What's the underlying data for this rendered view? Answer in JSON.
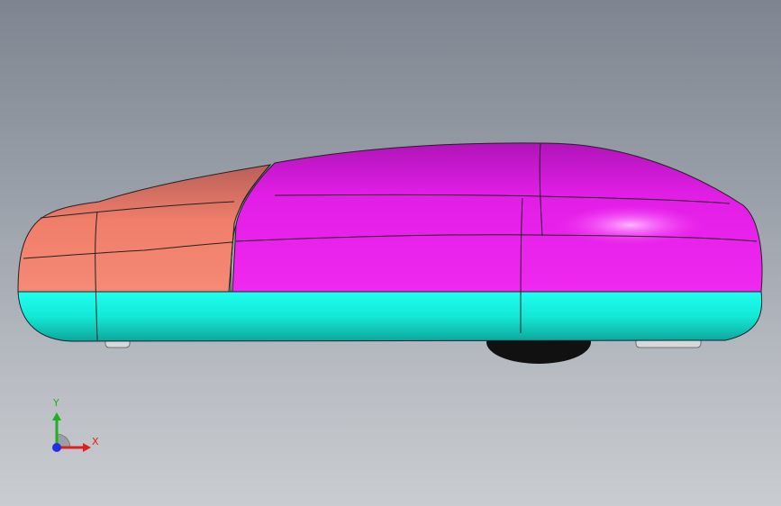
{
  "viewport": {
    "background_top": "#7e8590",
    "background_bottom": "#c9ccd0"
  },
  "model": {
    "body_colors": {
      "nose": "#f07e6a",
      "cabin": "#e81de8",
      "roof": "#b012b8",
      "underbody": "#18f0dc",
      "wheel": "#111111",
      "skid": "#d8d8d8"
    }
  },
  "triad": {
    "x_label": "X",
    "y_label": "Y",
    "x_color": "#e02020",
    "y_color": "#20b020",
    "z_color": "#2030e0"
  }
}
